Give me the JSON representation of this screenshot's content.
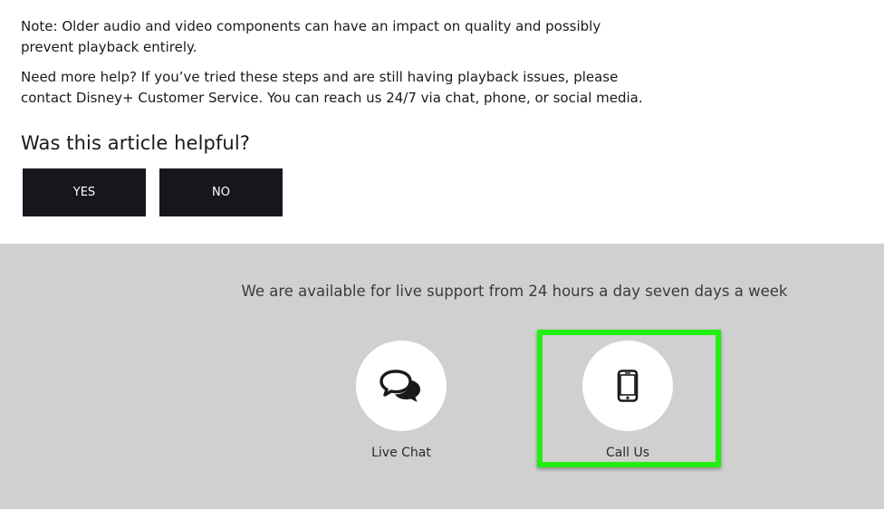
{
  "article": {
    "note_text": "Note: Older audio and video components can have an impact on quality and possibly prevent playback entirely.",
    "help_text": "Need more help? If you’ve tried these steps and are still having playback issues, please contact Disney+ Customer Service. You can reach us 24/7 via chat, phone, or social media.",
    "helpful_question": "Was this article helpful?",
    "yes_label": "YES",
    "no_label": "NO"
  },
  "support": {
    "availability_text": "We are available for live support from 24 hours a day seven days a week",
    "options": [
      {
        "label": "Live Chat",
        "icon": "chat-bubbles-icon"
      },
      {
        "label": "Call Us",
        "icon": "mobile-phone-icon"
      }
    ]
  },
  "colors": {
    "button_bg": "#16171d",
    "support_bg": "#d0d0d0",
    "highlight": "#22ee11"
  }
}
